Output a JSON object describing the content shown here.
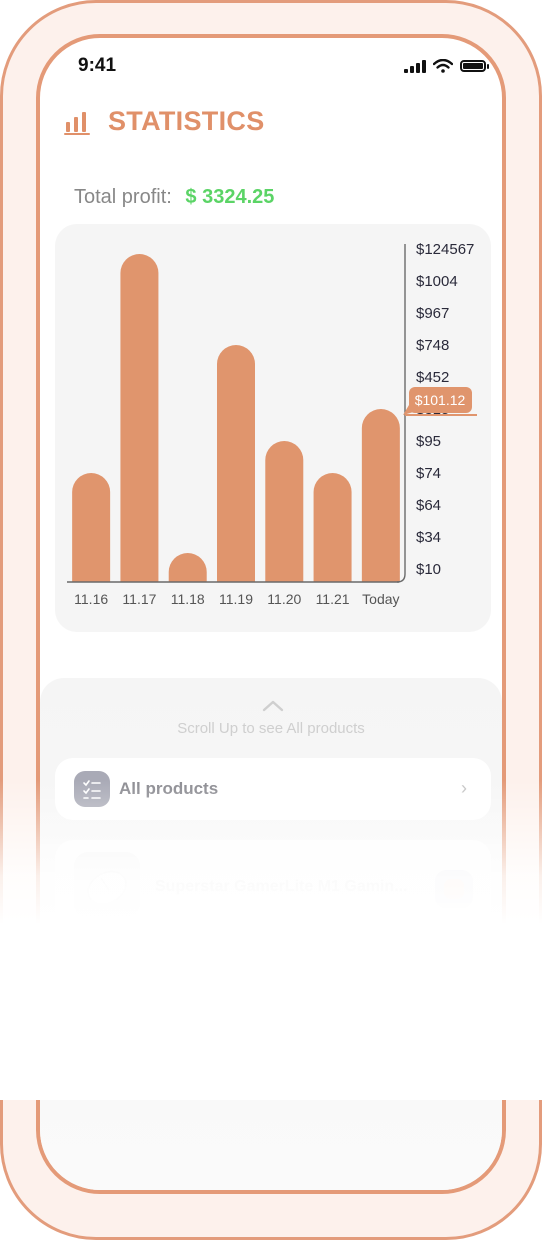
{
  "status_bar": {
    "time": "9:41"
  },
  "header": {
    "title": "STATISTICS",
    "icon": "bar-chart-icon"
  },
  "profit": {
    "label": "Total profit:",
    "value": "$ 3324.25"
  },
  "chart_data": {
    "type": "bar",
    "categories": [
      "11.16",
      "11.17",
      "11.18",
      "11.19",
      "11.20",
      "11.21",
      "Today"
    ],
    "values": [
      74,
      124567,
      10,
      748,
      95,
      74,
      315
    ],
    "y_tick_labels": [
      "$124567",
      "$1004",
      "$967",
      "$748",
      "$452",
      "$315",
      "$95",
      "$74",
      "$64",
      "$34",
      "$10"
    ],
    "tooltip": {
      "category": "Today",
      "label": "$101.12"
    },
    "bar_color": "#e0956d",
    "axis_color": "#6a6a6a",
    "y_axis_position": "right",
    "grid": false
  },
  "lower": {
    "scroll_hint": "Scroll Up to see All products",
    "all_products_label": "All products",
    "product_name": "Superstar GamerLite M1 Gamin..."
  },
  "colors": {
    "accent": "#e09069",
    "profit": "#5bd466"
  }
}
